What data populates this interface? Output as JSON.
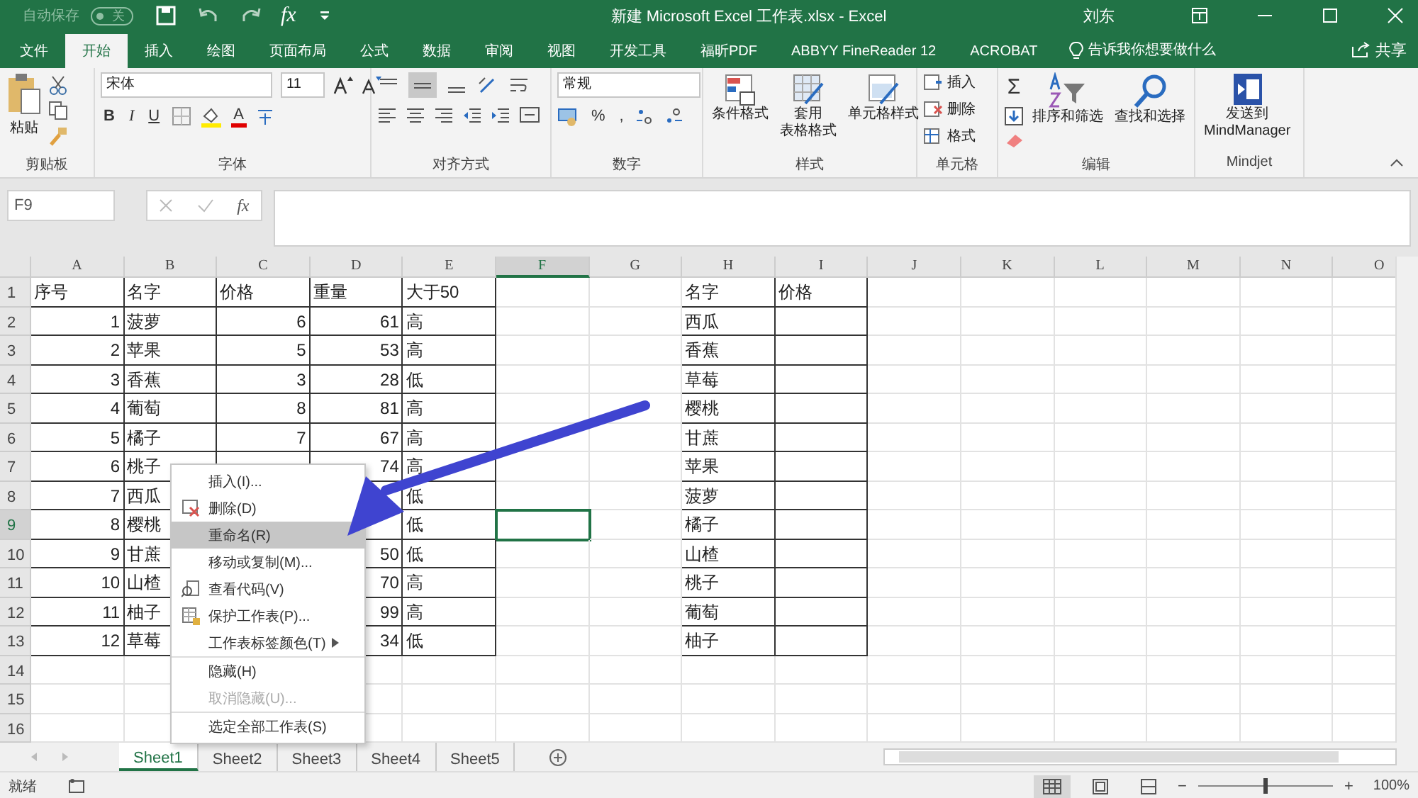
{
  "title_bar": {
    "autosave_label": "自动保存",
    "autosave_state": "关",
    "autosave_on": false,
    "quick_fx": "fx",
    "title": "新建 Microsoft Excel 工作表.xlsx  -  Excel",
    "user": "刘东"
  },
  "menu_tabs": [
    {
      "label": "文件",
      "selected": false
    },
    {
      "label": "开始",
      "selected": true
    },
    {
      "label": "插入",
      "selected": false
    },
    {
      "label": "绘图",
      "selected": false
    },
    {
      "label": "页面布局",
      "selected": false
    },
    {
      "label": "公式",
      "selected": false
    },
    {
      "label": "数据",
      "selected": false
    },
    {
      "label": "审阅",
      "selected": false
    },
    {
      "label": "视图",
      "selected": false
    },
    {
      "label": "开发工具",
      "selected": false
    },
    {
      "label": "福昕PDF",
      "selected": false
    },
    {
      "label": "ABBYY FineReader 12",
      "selected": false
    },
    {
      "label": "ACROBAT",
      "selected": false
    }
  ],
  "tell_me": "告诉我你想要做什么",
  "share": "共享",
  "ribbon": {
    "clipboard": {
      "label": "剪贴板",
      "paste": "粘贴"
    },
    "font": {
      "label": "字体",
      "font_name": "宋体",
      "font_size": "11",
      "bold": "B",
      "italic": "I",
      "underline": "U",
      "font_color": "A"
    },
    "alignment": {
      "label": "对齐方式"
    },
    "number": {
      "label": "数字",
      "format": "常规",
      "percent": "%",
      "comma": ","
    },
    "styles": {
      "label": "样式",
      "buttons": [
        {
          "kind": "conditional",
          "lines": [
            "条件格式"
          ]
        },
        {
          "kind": "table",
          "lines": [
            "套用",
            "表格格式"
          ]
        },
        {
          "kind": "cellstyle",
          "lines": [
            "单元格样式"
          ]
        }
      ]
    },
    "cells": {
      "label": "单元格",
      "items": [
        {
          "kind": "insert",
          "label": "插入"
        },
        {
          "kind": "delete",
          "label": "删除"
        },
        {
          "kind": "format",
          "label": "格式"
        }
      ]
    },
    "editing": {
      "label": "编辑",
      "sum": "Σ",
      "buttons": [
        {
          "kind": "sort",
          "label": "排序和筛选"
        },
        {
          "kind": "find",
          "label": "查找和选择"
        }
      ]
    },
    "mindjet": {
      "label": "Mindjet",
      "lines": [
        "发送到",
        "MindManager"
      ]
    }
  },
  "formula_bar": {
    "name_box": "F9",
    "fx": "fx"
  },
  "columns": [
    {
      "letter": "A",
      "numeric": true,
      "in_table": true,
      "selected": false
    },
    {
      "letter": "B",
      "numeric": false,
      "in_table": true,
      "selected": false
    },
    {
      "letter": "C",
      "numeric": true,
      "in_table": true,
      "selected": false
    },
    {
      "letter": "D",
      "numeric": true,
      "in_table": true,
      "selected": false
    },
    {
      "letter": "E",
      "numeric": false,
      "in_table": true,
      "selected": false
    },
    {
      "letter": "F",
      "numeric": false,
      "in_table": false,
      "selected": true
    },
    {
      "letter": "G",
      "numeric": false,
      "in_table": false,
      "selected": false
    },
    {
      "letter": "H",
      "numeric": false,
      "in_table": true,
      "selected": false
    },
    {
      "letter": "I",
      "numeric": false,
      "in_table": true,
      "selected": false
    },
    {
      "letter": "J",
      "numeric": false,
      "in_table": false,
      "selected": false
    },
    {
      "letter": "K",
      "numeric": false,
      "in_table": false,
      "selected": false
    },
    {
      "letter": "L",
      "numeric": false,
      "in_table": false,
      "selected": false
    },
    {
      "letter": "M",
      "numeric": false,
      "in_table": false,
      "selected": false
    },
    {
      "letter": "N",
      "numeric": false,
      "in_table": false,
      "selected": false
    },
    {
      "letter": "O",
      "numeric": false,
      "in_table": false,
      "selected": false
    }
  ],
  "rows": [
    {
      "number": "1",
      "kind": "header",
      "bordered": true,
      "selected": false,
      "cells": [
        "序号",
        "名字",
        "价格",
        "重量",
        "大于50",
        null,
        null,
        "名字",
        "价格"
      ]
    },
    {
      "number": "2",
      "kind": "data",
      "bordered": true,
      "selected": false,
      "cells": [
        "1",
        "菠萝",
        "6",
        "61",
        "高",
        null,
        null,
        "西瓜"
      ]
    },
    {
      "number": "3",
      "kind": "data",
      "bordered": true,
      "selected": false,
      "cells": [
        "2",
        "苹果",
        "5",
        "53",
        "高",
        null,
        null,
        "香蕉"
      ]
    },
    {
      "number": "4",
      "kind": "data",
      "bordered": true,
      "selected": false,
      "cells": [
        "3",
        "香蕉",
        "3",
        "28",
        "低",
        null,
        null,
        "草莓"
      ]
    },
    {
      "number": "5",
      "kind": "data",
      "bordered": true,
      "selected": false,
      "cells": [
        "4",
        "葡萄",
        "8",
        "81",
        "高",
        null,
        null,
        "樱桃"
      ]
    },
    {
      "number": "6",
      "kind": "data",
      "bordered": true,
      "selected": false,
      "cells": [
        "5",
        "橘子",
        "7",
        "67",
        "高",
        null,
        null,
        "甘蔗"
      ]
    },
    {
      "number": "7",
      "kind": "data",
      "bordered": true,
      "selected": false,
      "cells": [
        "6",
        "桃子",
        null,
        "74",
        "高",
        null,
        null,
        "苹果"
      ]
    },
    {
      "number": "8",
      "kind": "data",
      "bordered": true,
      "selected": false,
      "cells": [
        "7",
        "西瓜",
        null,
        null,
        "低",
        null,
        null,
        "菠萝"
      ]
    },
    {
      "number": "9",
      "kind": "data",
      "bordered": true,
      "selected": true,
      "cells": [
        "8",
        "樱桃",
        null,
        null,
        "低",
        null,
        null,
        "橘子"
      ]
    },
    {
      "number": "10",
      "kind": "data",
      "bordered": true,
      "selected": false,
      "cells": [
        "9",
        "甘蔗",
        null,
        "50",
        "低",
        null,
        null,
        "山楂"
      ]
    },
    {
      "number": "11",
      "kind": "data",
      "bordered": true,
      "selected": false,
      "cells": [
        "10",
        "山楂",
        null,
        "70",
        "高",
        null,
        null,
        "桃子"
      ]
    },
    {
      "number": "12",
      "kind": "data",
      "bordered": true,
      "selected": false,
      "cells": [
        "11",
        "柚子",
        null,
        "99",
        "高",
        null,
        null,
        "葡萄"
      ]
    },
    {
      "number": "13",
      "kind": "data",
      "bordered": true,
      "selected": false,
      "cells": [
        "12",
        "草莓",
        null,
        "34",
        "低",
        null,
        null,
        "柚子"
      ]
    },
    {
      "number": "14",
      "kind": "data",
      "bordered": false,
      "selected": false
    },
    {
      "number": "15",
      "kind": "data",
      "bordered": false,
      "selected": false
    },
    {
      "number": "16",
      "kind": "data",
      "bordered": false,
      "selected": false
    }
  ],
  "context_menu": [
    {
      "label": "插入(I)...",
      "kind": "plain",
      "selected": false,
      "disabled": false,
      "separator_before": false
    },
    {
      "label": "删除(D)",
      "kind": "delete",
      "selected": false,
      "disabled": false,
      "separator_before": false
    },
    {
      "label": "重命名(R)",
      "kind": "plain",
      "selected": true,
      "disabled": false,
      "separator_before": false
    },
    {
      "label": "移动或复制(M)...",
      "kind": "plain",
      "selected": false,
      "disabled": false,
      "separator_before": false
    },
    {
      "label": "查看代码(V)",
      "kind": "code",
      "selected": false,
      "disabled": false,
      "separator_before": false
    },
    {
      "label": "保护工作表(P)...",
      "kind": "protect",
      "selected": false,
      "disabled": false,
      "separator_before": false
    },
    {
      "label": "工作表标签颜色(T)",
      "kind": "submenu",
      "selected": false,
      "disabled": false,
      "separator_before": false
    },
    {
      "label": "隐藏(H)",
      "kind": "plain",
      "selected": false,
      "disabled": false,
      "separator_before": true
    },
    {
      "label": "取消隐藏(U)...",
      "kind": "plain",
      "selected": false,
      "disabled": true,
      "separator_before": false
    },
    {
      "label": "选定全部工作表(S)",
      "kind": "plain",
      "selected": false,
      "disabled": false,
      "separator_before": true
    }
  ],
  "sheet_tabs": [
    {
      "label": "Sheet1",
      "selected": true
    },
    {
      "label": "Sheet2",
      "selected": false
    },
    {
      "label": "Sheet3",
      "selected": false
    },
    {
      "label": "Sheet4",
      "selected": false
    },
    {
      "label": "Sheet5",
      "selected": false
    }
  ],
  "status_bar": {
    "status": "就绪",
    "zoom_out": "−",
    "zoom": {
      "level": 0.5
    },
    "zoom_in": "+",
    "zoom_label": "100%"
  }
}
